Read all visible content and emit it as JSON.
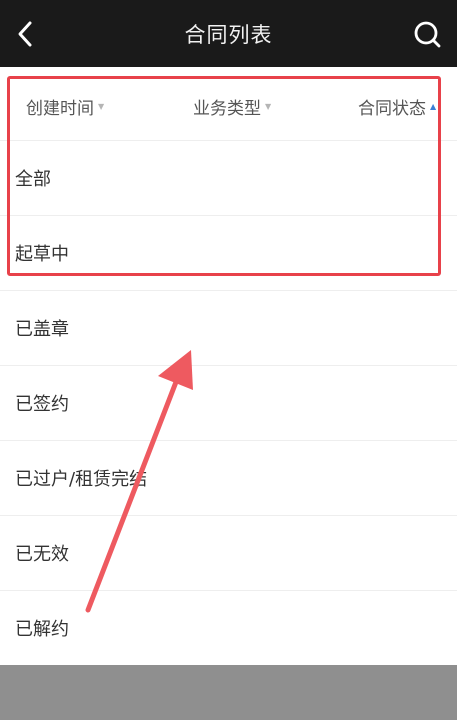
{
  "header": {
    "title": "合同列表",
    "back_icon": "chevron-left-icon",
    "search_icon": "search-icon"
  },
  "filters": [
    {
      "label": "创建时间",
      "caret": "▼",
      "active": false
    },
    {
      "label": "业务类型",
      "caret": "▼",
      "active": false
    },
    {
      "label": "合同状态",
      "caret": "▲",
      "active": true
    }
  ],
  "status_options": [
    {
      "label": "全部"
    },
    {
      "label": "起草中"
    },
    {
      "label": "已盖章"
    },
    {
      "label": "已签约"
    },
    {
      "label": "已过户/租赁完结"
    },
    {
      "label": "已无效"
    },
    {
      "label": "已解约"
    }
  ],
  "annotation_colors": {
    "highlight": "#e8414a",
    "arrow": "#ee5a60"
  }
}
